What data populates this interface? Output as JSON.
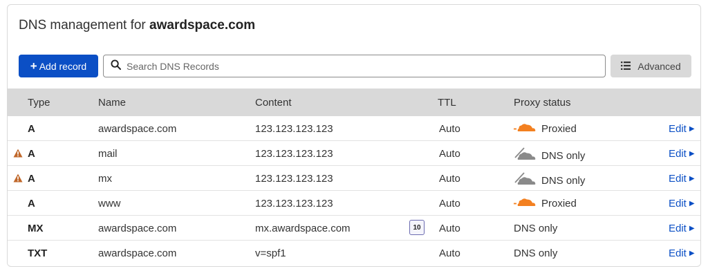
{
  "header": {
    "title_prefix": "DNS management for ",
    "domain": "awardspace.com"
  },
  "toolbar": {
    "add_plus": "+",
    "add_label": "Add record",
    "search_placeholder": "Search DNS Records",
    "search_value": "",
    "advanced_label": "Advanced"
  },
  "table": {
    "headers": {
      "type": "Type",
      "name": "Name",
      "content": "Content",
      "ttl": "TTL",
      "proxy": "Proxy status"
    },
    "rows": [
      {
        "warning": false,
        "type": "A",
        "name": "awardspace.com",
        "content": "123.123.123.123",
        "priority": "",
        "ttl": "Auto",
        "proxy_icon": "cloud-orange-icon",
        "proxy": "Proxied",
        "edit": "Edit"
      },
      {
        "warning": true,
        "type": "A",
        "name": "mail",
        "content": "123.123.123.123",
        "priority": "",
        "ttl": "Auto",
        "proxy_icon": "cloud-grey-icon",
        "proxy": "DNS only",
        "edit": "Edit"
      },
      {
        "warning": true,
        "type": "A",
        "name": "mx",
        "content": "123.123.123.123",
        "priority": "",
        "ttl": "Auto",
        "proxy_icon": "cloud-grey-icon",
        "proxy": "DNS only",
        "edit": "Edit"
      },
      {
        "warning": false,
        "type": "A",
        "name": "www",
        "content": "123.123.123.123",
        "priority": "",
        "ttl": "Auto",
        "proxy_icon": "cloud-orange-icon",
        "proxy": "Proxied",
        "edit": "Edit"
      },
      {
        "warning": false,
        "type": "MX",
        "name": "awardspace.com",
        "content": "mx.awardspace.com",
        "priority": "10",
        "ttl": "Auto",
        "proxy_icon": "",
        "proxy": "DNS only",
        "edit": "Edit"
      },
      {
        "warning": false,
        "type": "TXT",
        "name": "awardspace.com",
        "content": "v=spf1",
        "priority": "",
        "ttl": "Auto",
        "proxy_icon": "",
        "proxy": "DNS only",
        "edit": "Edit"
      }
    ]
  },
  "colors": {
    "accent": "#0b4fc5",
    "proxied_cloud": "#f38020",
    "dns_only_cloud": "#8a8a8a",
    "warning": "#c0672a",
    "header_bg": "#d9d9d9"
  }
}
